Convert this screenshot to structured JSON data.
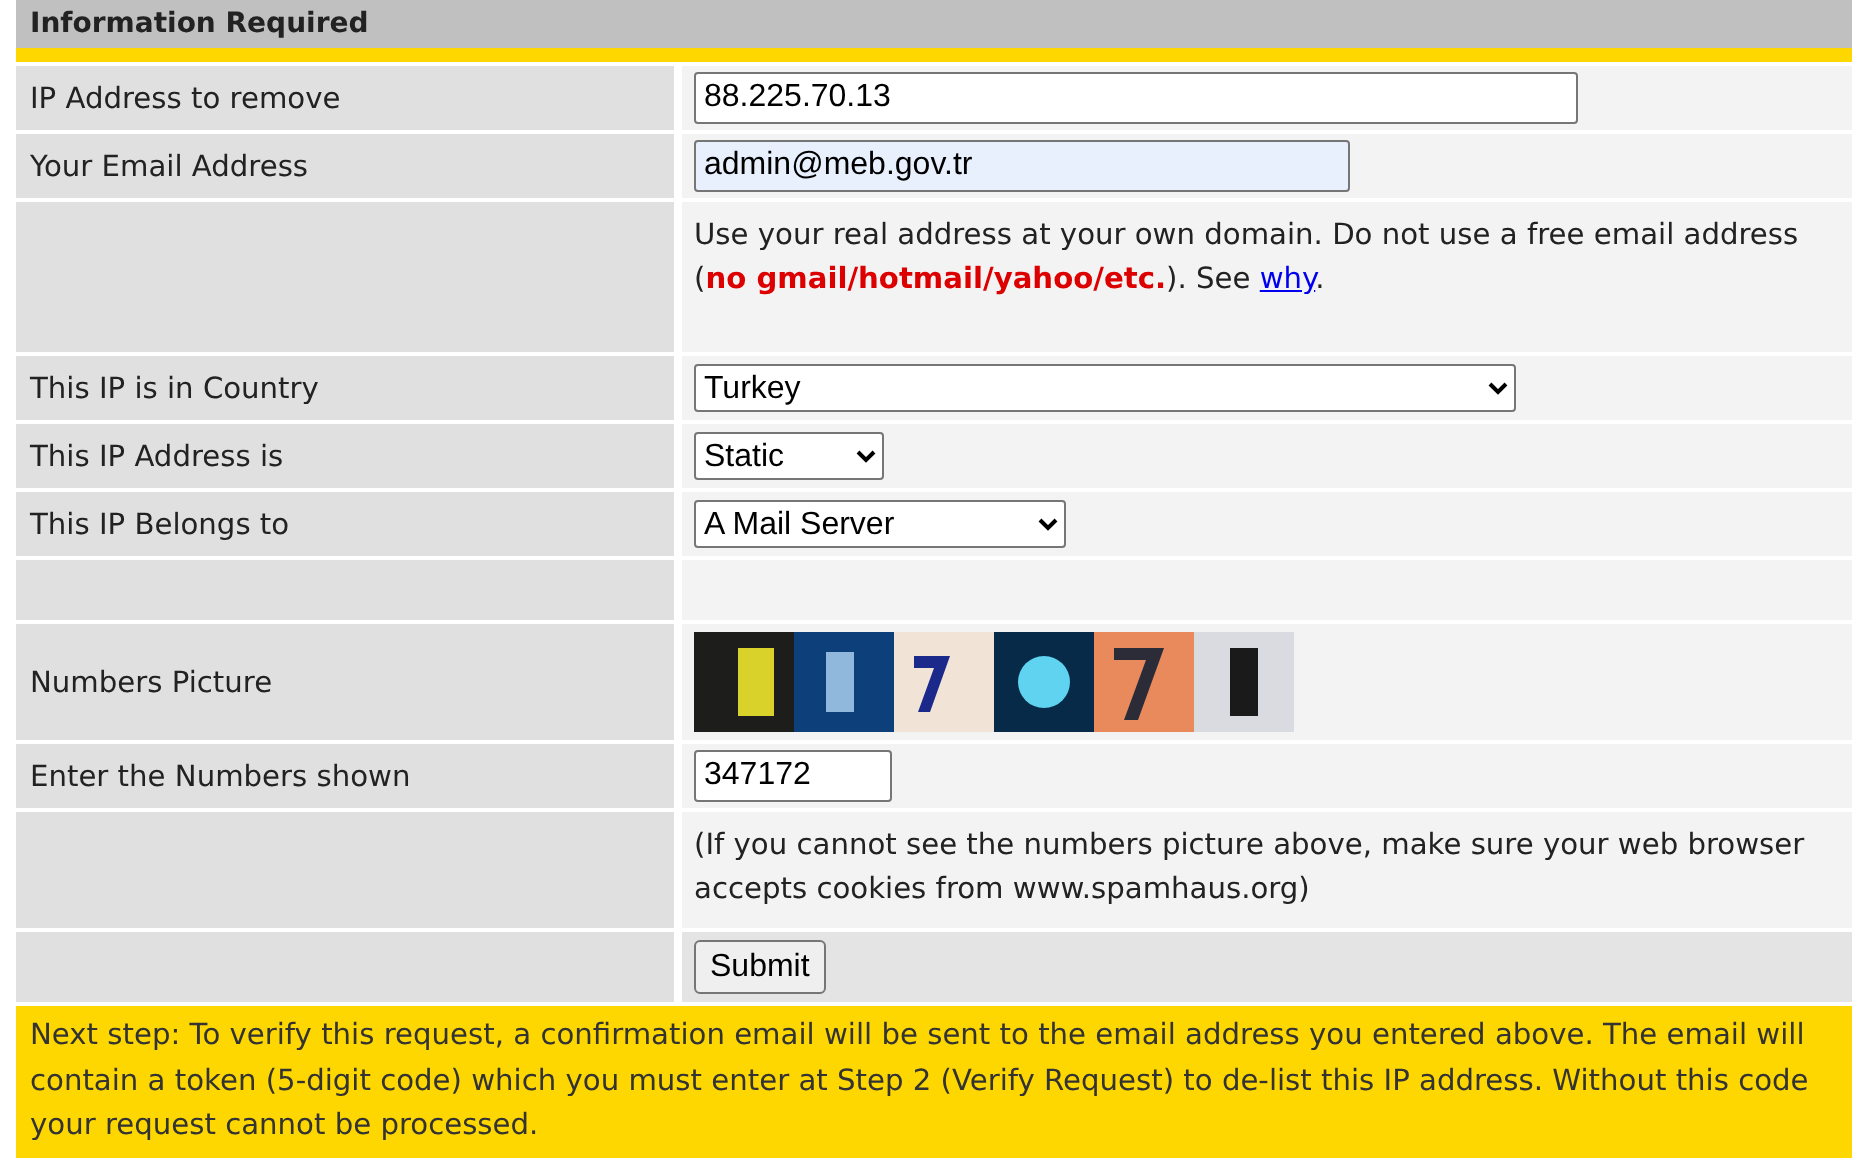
{
  "header": {
    "title": "Information Required"
  },
  "rows": [
    {
      "kind": "input",
      "label": "IP Address to remove",
      "value": "88.225.70.13",
      "highlighted": false
    },
    {
      "kind": "input",
      "label": "Your Email Address",
      "value": "admin@meb.gov.tr",
      "highlighted": true
    },
    {
      "kind": "note",
      "before": "Use your real address at your own domain. Do not use a free email address (**no gmail/hotmail/yahoo/etc.**). See ",
      "link": "why",
      "after": "."
    },
    {
      "kind": "select",
      "label": "This IP is in Country",
      "value": "Turkey"
    },
    {
      "kind": "select",
      "label": "This IP Address is",
      "value": "Static"
    },
    {
      "kind": "select",
      "label": "This IP Belongs to",
      "value": "A Mail Server"
    },
    {
      "kind": "empty"
    },
    {
      "kind": "picture",
      "label": "Numbers Picture"
    },
    {
      "kind": "input",
      "label": "Enter the Numbers shown",
      "value": "347172",
      "highlighted": false
    },
    {
      "kind": "note",
      "before": "(If you cannot see the numbers picture above, make sure your web browser accepts cookies from www.spamhaus.org)"
    },
    {
      "kind": "button",
      "label": "Submit"
    }
  ],
  "footer": {
    "text": "Next step: To verify this request, a confirmation email will be sent to the email address you entered above. The email will contain a token (5-digit code) which you must enter at Step 2 (Verify Request) to de-list this IP address. Without this code your request cannot be processed."
  }
}
